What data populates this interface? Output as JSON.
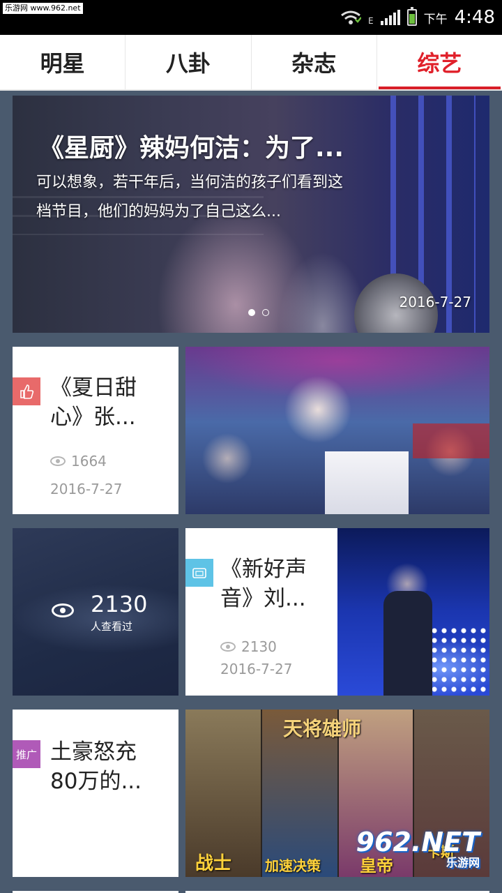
{
  "status_bar": {
    "watermark": "乐游网 www.962.net",
    "network": "E",
    "ampm": "下午",
    "time": "4:48",
    "battery_level": 0.7
  },
  "tabs": [
    {
      "label": "明星",
      "active": false
    },
    {
      "label": "八卦",
      "active": false
    },
    {
      "label": "杂志",
      "active": false
    },
    {
      "label": "综艺",
      "active": true
    }
  ],
  "hero": {
    "title": "《星厨》辣妈何洁：为了...",
    "description": "可以想象，若干年后，当何洁的孩子们看到这档节目，他们的妈妈为了自己这么...",
    "date": "2016-7-27",
    "slides": 2,
    "current_slide": 1
  },
  "cards": [
    {
      "title": "《夏日甜心》张...",
      "views": "1664",
      "date": "2016-7-27",
      "badge_icon": "thumbs-up-icon",
      "badge_color": "#e86a6a"
    },
    {
      "title": "《新好声音》刘...",
      "views": "2130",
      "date": "2016-7-27",
      "badge_icon": "tv-icon",
      "badge_color": "#5ec3e6"
    },
    {
      "title": "土豪怒充80万的...",
      "badge_label": "推广",
      "badge_color": "#b05ab8"
    }
  ],
  "stat": {
    "count": "2130",
    "label": "人查看过"
  },
  "ad_image": {
    "logo_text": "天将雄师",
    "captions": [
      "战士",
      "加速决策",
      "皇帝",
      "卡斯"
    ]
  },
  "watermark": {
    "logo": "962.NET",
    "sub": "乐游网"
  }
}
